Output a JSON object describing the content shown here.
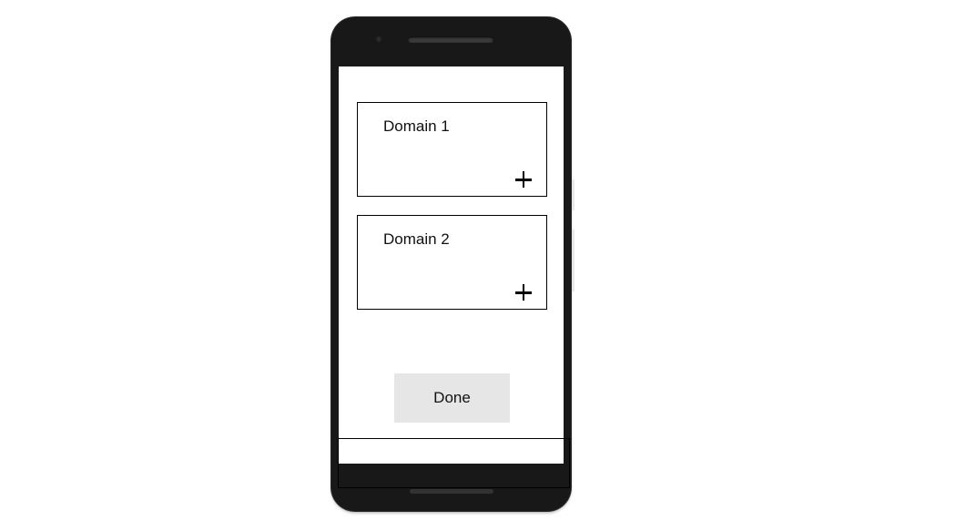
{
  "screen": {
    "domains": [
      {
        "title": "Domain 1",
        "add_icon": "plus-icon"
      },
      {
        "title": "Domain 2",
        "add_icon": "plus-icon"
      }
    ],
    "done_label": "Done"
  },
  "colors": {
    "phone_body": "#181818",
    "screen_bg": "#ffffff",
    "button_bg": "#e6e6e6",
    "border": "#000000"
  }
}
